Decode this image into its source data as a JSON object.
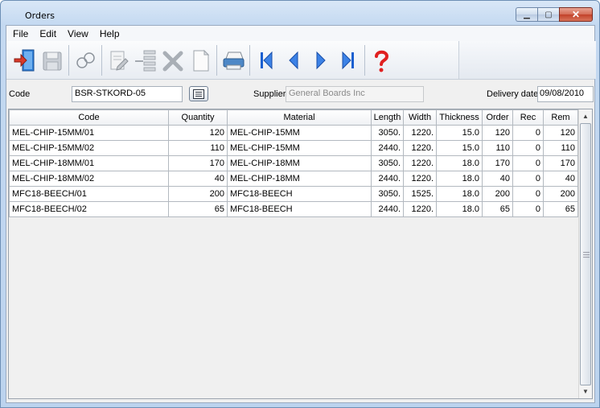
{
  "window": {
    "title": "Orders"
  },
  "menu": [
    "File",
    "Edit",
    "View",
    "Help"
  ],
  "toolbar": {
    "icons": [
      "exit-icon",
      "save-icon",
      "find-icon",
      "edit-icon",
      "insert-row-icon",
      "delete-icon",
      "new-document-icon",
      "print-icon",
      "first-record-icon",
      "previous-record-icon",
      "next-record-icon",
      "last-record-icon",
      "help-icon"
    ]
  },
  "form": {
    "code_label": "Code",
    "code_value": "BSR-STKORD-05",
    "supplier_label": "Supplier",
    "supplier_value": "General Boards Inc",
    "delivery_label": "Delivery date",
    "delivery_value": "09/08/2010"
  },
  "grid": {
    "columns": [
      "Code",
      "Quantity",
      "Material",
      "Length",
      "Width",
      "Thickness",
      "Order",
      "Rec",
      "Rem"
    ],
    "rows": [
      [
        "MEL-CHIP-15MM/01",
        "120",
        "MEL-CHIP-15MM",
        "3050.",
        "1220.",
        "15.0",
        "120",
        "0",
        "120"
      ],
      [
        "MEL-CHIP-15MM/02",
        "110",
        "MEL-CHIP-15MM",
        "2440.",
        "1220.",
        "15.0",
        "110",
        "0",
        "110"
      ],
      [
        "MEL-CHIP-18MM/01",
        "170",
        "MEL-CHIP-18MM",
        "3050.",
        "1220.",
        "18.0",
        "170",
        "0",
        "170"
      ],
      [
        "MEL-CHIP-18MM/02",
        "40",
        "MEL-CHIP-18MM",
        "2440.",
        "1220.",
        "18.0",
        "40",
        "0",
        "40"
      ],
      [
        "MFC18-BEECH/01",
        "200",
        "MFC18-BEECH",
        "3050.",
        "1525.",
        "18.0",
        "200",
        "0",
        "200"
      ],
      [
        "MFC18-BEECH/02",
        "65",
        "MFC18-BEECH",
        "2440.",
        "1220.",
        "18.0",
        "65",
        "0",
        "65"
      ]
    ]
  },
  "colors": {
    "accent_blue": "#1a5fd0",
    "help_red": "#e02020",
    "close_red": "#c2422a"
  }
}
